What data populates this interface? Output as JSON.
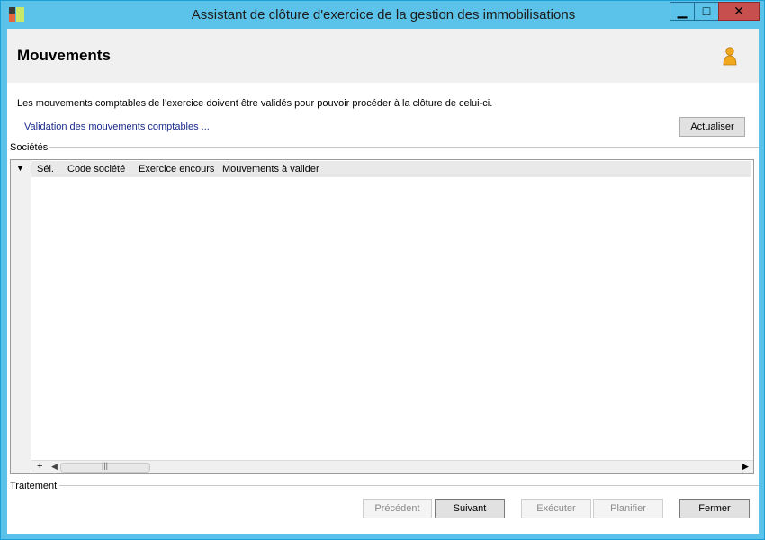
{
  "window": {
    "title": "Assistant de clôture d'exercice de la gestion des immobilisations",
    "icons": {
      "app": "app-icon",
      "minimize": "minimize-icon",
      "maximize": "maximize-icon",
      "close": "close-icon"
    },
    "controls": {
      "minimize": "▁",
      "maximize": "□",
      "close": "✕"
    }
  },
  "header": {
    "title": "Mouvements",
    "icon": "user-icon"
  },
  "message": "Les mouvements comptables de l’exercice doivent être validés pour pouvoir procéder à la clôture de celui-ci.",
  "status": "Validation des mouvements comptables ...",
  "actualiser_label": "Actualiser",
  "societes": {
    "label": "Sociétés",
    "grid": {
      "dropdown": "▼",
      "columns": [
        "Sél.",
        "Code société",
        "Exercice encours",
        "Mouvements à valider"
      ],
      "rows": [],
      "scroll": {
        "plus": "+",
        "left": "◀",
        "grip": "|||",
        "right": "▶"
      }
    }
  },
  "traitement": {
    "label": "Traitement"
  },
  "buttons": {
    "precedent": "Précédent",
    "suivant": "Suivant",
    "executer": "Exécuter",
    "planifier": "Planifier",
    "fermer": "Fermer"
  },
  "colors": {
    "titlebar": "#5bc3ea",
    "close": "#c7504f",
    "status_text": "#1a2a8c",
    "user_icon": "#f2a81d"
  }
}
